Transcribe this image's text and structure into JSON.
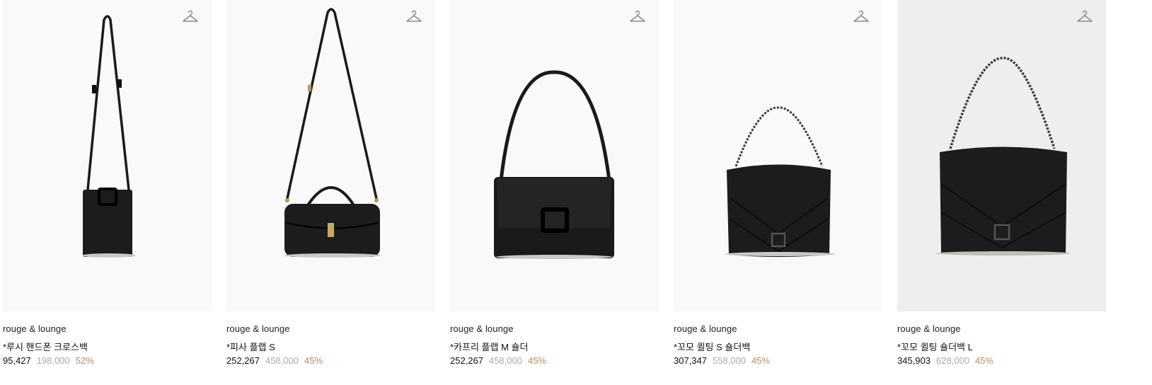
{
  "products": [
    {
      "brand": "rouge & lounge",
      "name": "*루시 핸드폰 크로스백",
      "price": "95,427",
      "original_price": "198,000",
      "discount": "52%",
      "image_icon": "bag-image"
    },
    {
      "brand": "rouge & lounge",
      "name": "*피사 플랩 S",
      "price": "252,267",
      "original_price": "458,000",
      "discount": "45%",
      "image_icon": "bag-image"
    },
    {
      "brand": "rouge & lounge",
      "name": "*카프리 플랩 M 숄더",
      "price": "252,267",
      "original_price": "458,000",
      "discount": "45%",
      "image_icon": "bag-image"
    },
    {
      "brand": "rouge & lounge",
      "name": "*꼬모 퀼팅 S 숄더백",
      "price": "307,347",
      "original_price": "558,000",
      "discount": "45%",
      "image_icon": "bag-image"
    },
    {
      "brand": "rouge & lounge",
      "name": "*꼬모 퀼팅 숄더백 L",
      "price": "345,903",
      "original_price": "628,000",
      "discount": "45%",
      "image_icon": "bag-image"
    }
  ],
  "icons": {
    "wishlist": "hanger-icon"
  },
  "colors": {
    "discount": "#b98a5e",
    "original_price": "#a9a9a9",
    "price": "#111111",
    "bag": "#1a1a1a"
  }
}
